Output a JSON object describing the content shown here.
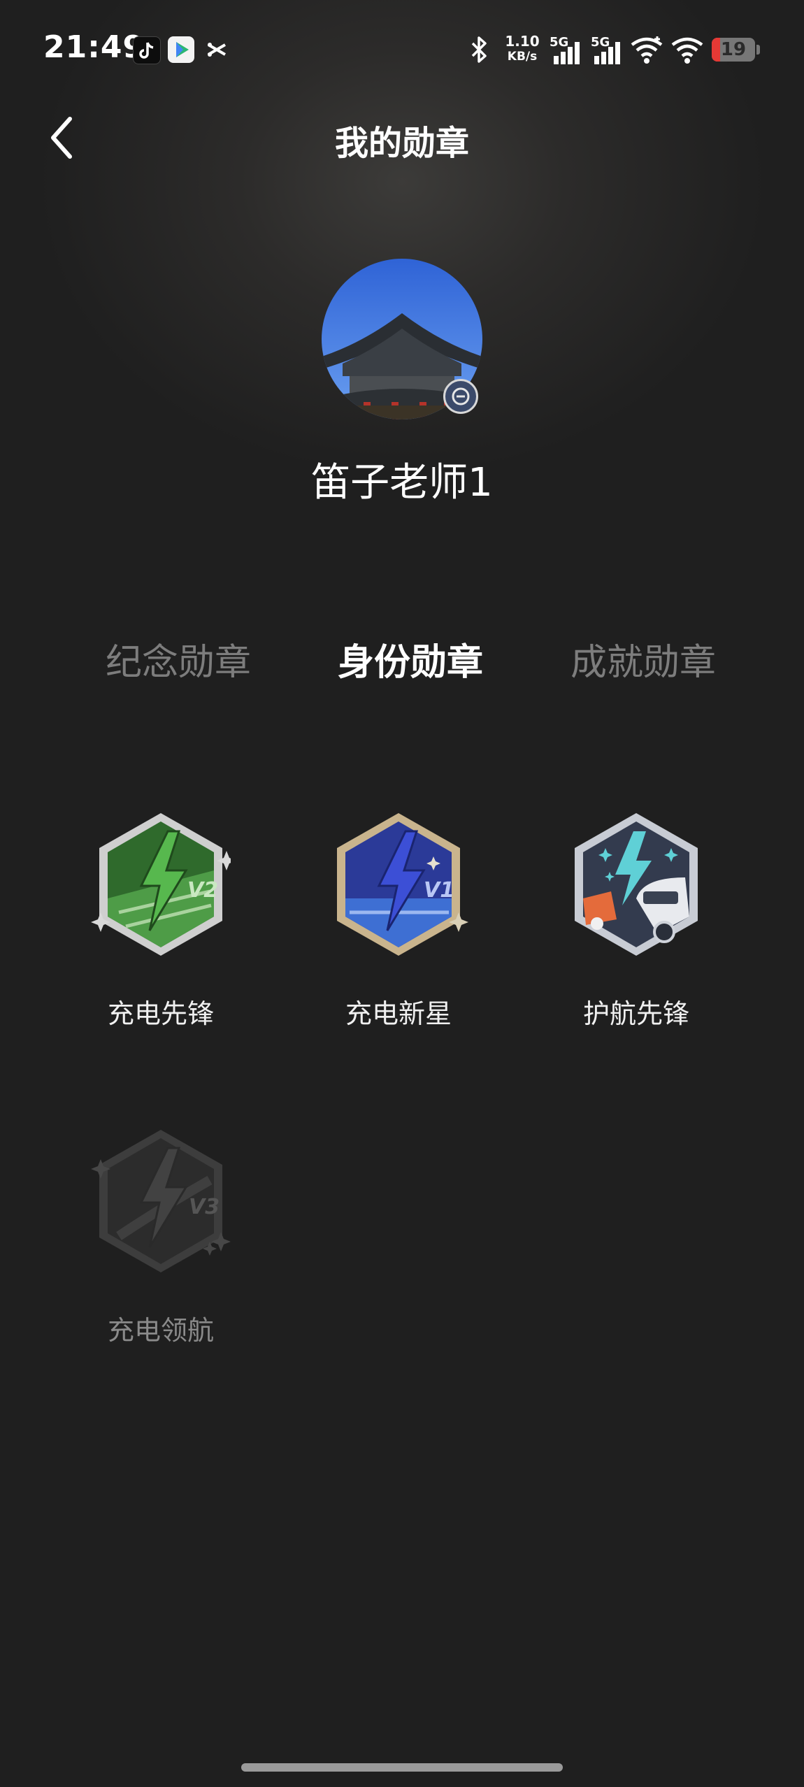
{
  "status_bar": {
    "time": "21:49",
    "network_speed_value": "1.10",
    "network_speed_unit": "KB/s",
    "signal_1_label": "5G",
    "signal_2_label": "5G",
    "battery_level": "19",
    "icons": [
      "tiktok-icon",
      "video-play-icon",
      "scissors-icon",
      "bluetooth-icon",
      "signal-icon",
      "wifi-icon",
      "battery-icon"
    ]
  },
  "header": {
    "title": "我的勋章",
    "back_icon": "chevron-left-icon"
  },
  "profile": {
    "name": "笛子老师1"
  },
  "tabs": [
    {
      "label": "纪念勋章",
      "active": false
    },
    {
      "label": "身份勋章",
      "active": true
    },
    {
      "label": "成就勋章",
      "active": false
    }
  ],
  "badges": [
    {
      "label": "充电先锋",
      "tier": "V2",
      "unlocked": true,
      "color": "#3f8a3b"
    },
    {
      "label": "充电新星",
      "tier": "V1",
      "unlocked": true,
      "color": "#3448b8"
    },
    {
      "label": "护航先锋",
      "tier": "",
      "unlocked": true,
      "color": "#3b4458"
    },
    {
      "label": "充电领航",
      "tier": "V3",
      "unlocked": false,
      "color": "#3a3a3a"
    }
  ]
}
